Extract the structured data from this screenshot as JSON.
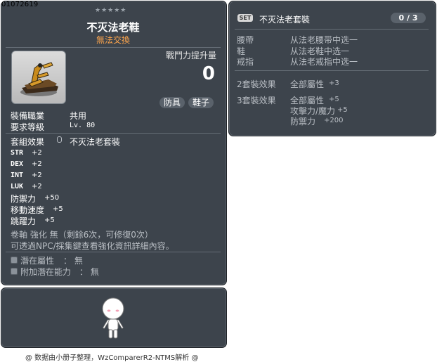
{
  "item": {
    "id": "01072619",
    "stars": "★★★★★",
    "name": "不灭法老鞋",
    "trade_status": "無法交換",
    "power_label": "戰鬥力提升量",
    "power_value": "0",
    "tags": [
      "防具",
      "鞋子"
    ],
    "job_label": "裝備職業",
    "job_value": "共用",
    "level_label": "要求等級",
    "level_value": "Lv. 80",
    "set_label": "套組效果",
    "set_name": "不灭法老套裝",
    "stats": [
      {
        "name": "STR",
        "value": "+2"
      },
      {
        "name": "DEX",
        "value": "+2"
      },
      {
        "name": "INT",
        "value": "+2"
      },
      {
        "name": "LUK",
        "value": "+2"
      }
    ],
    "stats_big": [
      {
        "name": "防禦力",
        "value": "+50"
      },
      {
        "name": "移動速度",
        "value": "+5"
      },
      {
        "name": "跳躍力",
        "value": "+5"
      }
    ],
    "scroll_text": "卷軸 強化 無（剩餘6次，可修復0次）",
    "npc_text": "可透過NPC/採集鍵查看強化資訊詳細內容。",
    "potential_label": "潛在屬性",
    "potential_value": "： 無",
    "bonus_potential_label": "附加潛在能力",
    "bonus_potential_value": "： 無"
  },
  "set_panel": {
    "badge": "SET",
    "name": "不灭法老套裝",
    "count": "0 / 3",
    "parts": [
      {
        "slot": "腰帶",
        "choice": "从法老腰带中选一"
      },
      {
        "slot": "鞋",
        "choice": "从法老鞋中选一"
      },
      {
        "slot": "戒指",
        "choice": "从法老戒指中选一"
      }
    ],
    "effect2_label": "2套裝效果",
    "effect2_name": "全部屬性",
    "effect2_value": "+3",
    "effect3_label": "3套裝效果",
    "effect3_lines": [
      {
        "name": "全部屬性",
        "value": "+5"
      },
      {
        "name": "攻擊力/魔力",
        "value": "+5"
      },
      {
        "name": "防禦力",
        "value": "+200"
      }
    ]
  },
  "footer": "@ 数据由小册子整理，WzComparerR2-NTMS解析 @"
}
